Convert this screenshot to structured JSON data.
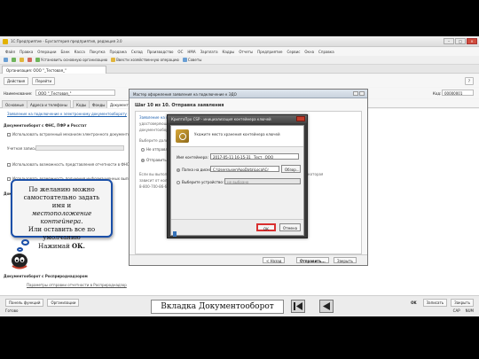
{
  "app": {
    "title": "1С:Предприятие - Бухгалтерия предприятия, редакция 3.0",
    "window_buttons": [
      "–",
      "□",
      "×"
    ],
    "menu": [
      "Файл",
      "Правка",
      "Операции",
      "Банк",
      "Касса",
      "Покупка",
      "Продажа",
      "Склад",
      "Производство",
      "ОС",
      "НМА",
      "Зарплата",
      "Кадры",
      "Отчеты",
      "Предприятие",
      "Сервис",
      "Окна",
      "Справка"
    ],
    "toolbar": [
      "Установить основную организацию",
      "Ввести хозяйственную операцию",
      "Советы"
    ],
    "doc_tab": "Организация: ООО \"_Тестовая_\"",
    "form_actions": [
      "Действия",
      "Перейти"
    ],
    "help": "?",
    "name_label": "Наименование:",
    "name_value": "ООО \"_Тестовая_\"",
    "code_label": "Код:",
    "code_value": "00000001",
    "subtabs": [
      "Основные",
      "Адреса и телефоны",
      "Коды",
      "Фонды",
      "Документооборот"
    ]
  },
  "content": {
    "link_statement": "Заявление на подключение к электронному документообороту",
    "section_docflow": "Документооборот с ФНС, ПФР и Росстат",
    "opt_builtin": "Использовать встроенный механизм электронного документооборота",
    "opt_crypto": "Учетная запись",
    "opt_report": "Использовать возможность представления отчетности в ФНС по",
    "opt_info": "Использовать возможность получения информационных выписок",
    "opt_fss": "Документооборот с ФСС",
    "opt_rpn": "Документооборот с Росприроднадзором",
    "opt_rpn2": "Параметры отправки отчетности в Росприроднадзор"
  },
  "bottom": {
    "panel": [
      "Панель функций",
      "Организации"
    ],
    "ok": "OK",
    "save": "Записать",
    "close": "Закрыть",
    "status_ready": "Готово",
    "caps": "CAP",
    "num": "NUM"
  },
  "wizard": {
    "title": "Мастер оформления заявления на подключение к ЭДО",
    "step": "Шаг 10 из 10. Отправка заявления",
    "text": [
      "Заявление на подключение к ЭДО сформировано и будет отправлено в спецоператор.",
      "удостоверяющий центр. После получения ответа",
      "документооборота.",
      "Выберите дальнейшие действия:",
      "Не отправлять",
      "Отправить заявление",
      "Если вы выполнили все необходимые действия, то отправьте заявление и организацию, которая",
      "зависит от количества процедур (регламентирующих лицензионное соглашение на",
      "8-800-700-86-68 или адрес"
    ],
    "back": "< Назад",
    "send": "Отправить...",
    "close": "Закрыть"
  },
  "crypto": {
    "title": "КриптоПро CSP - инициализация контейнера ключей",
    "header": "Укажите место хранения контейнера ключей",
    "container_label": "Имя контейнера:",
    "container_value": "2017-05-11 16-15-31 _Тест_ ООО",
    "folder_label": "Папка на диске:",
    "folder_value": "C:\\Users\\user\\AppData\\Local\\Cr",
    "browse": "Обзор...",
    "device_label": "Выберите устройство:",
    "device_value": "не выбрано",
    "ok": "ОК",
    "cancel": "Отмена"
  },
  "callout": {
    "line1": "По желанию можно",
    "line2": "самостоятельно задать имя и",
    "line3_italic": "местоположение контейнера.",
    "line4": "Или оставить все по умолчанию",
    "line5": "Нажимай ",
    "line5_bold": "ОК."
  },
  "nav": {
    "title": "Вкладка Документооборот"
  }
}
